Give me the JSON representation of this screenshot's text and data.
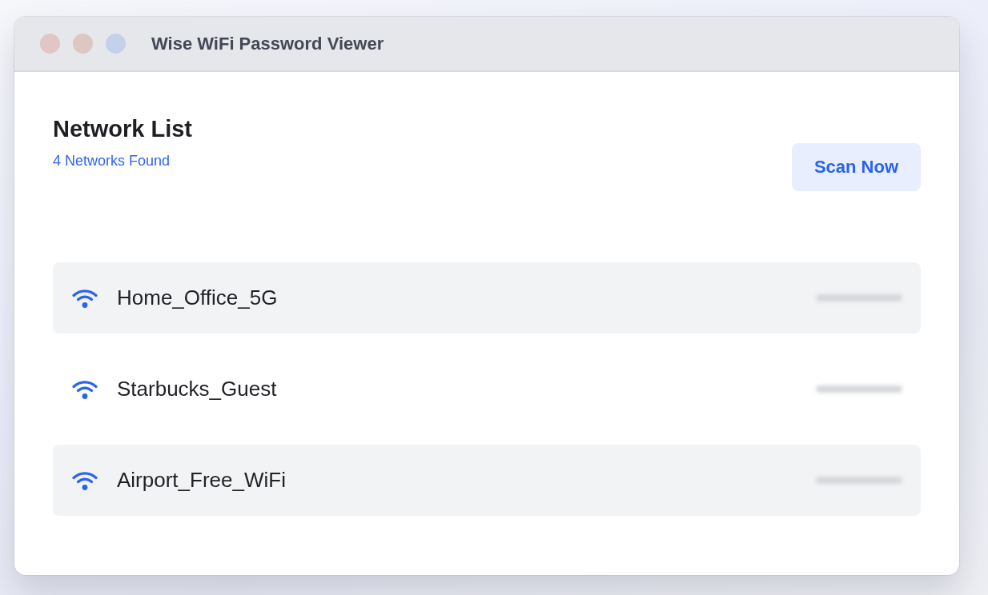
{
  "window": {
    "title": "Wise WiFi Password Viewer"
  },
  "header": {
    "title": "Network List",
    "subtitle": "4 Networks Found",
    "scan_button": "Scan Now"
  },
  "networks": [
    {
      "name": "Home_Office_5G"
    },
    {
      "name": "Starbucks_Guest"
    },
    {
      "name": "Airport_Free_WiFi"
    }
  ]
}
